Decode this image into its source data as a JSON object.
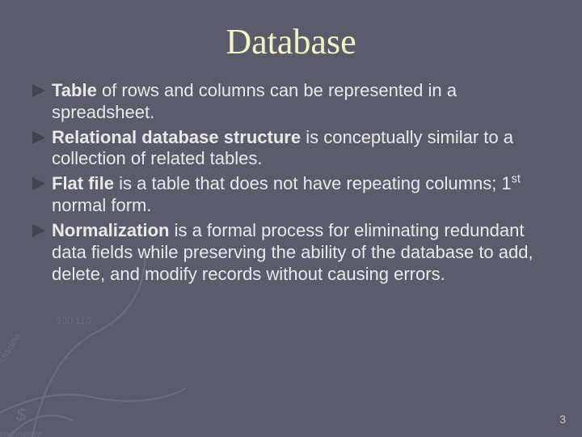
{
  "title": "Database",
  "page_number": "3",
  "arrow_color": "#414350",
  "bullets": [
    {
      "lead": "Table",
      "rest": " of rows and columns can be represented in a spreadsheet."
    },
    {
      "lead": "Relational database structure",
      "rest": " is conceptually similar to a collection of related tables."
    },
    {
      "lead": "Flat file",
      "rest_html": " is a table that does not have repeating columns; 1<sup>st</sup> normal form."
    },
    {
      "lead": "Normalization",
      "rest": " is a formal process for eliminating redundant data fields while preserving the ability of the database to add, delete, and modify records without causing errors."
    }
  ]
}
